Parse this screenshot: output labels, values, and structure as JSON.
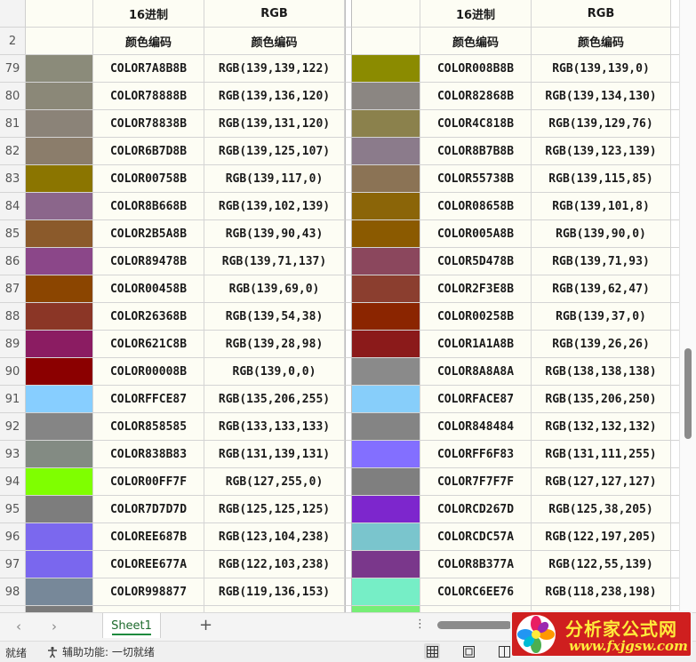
{
  "headers": {
    "row1": {
      "num": "",
      "hex": "16进制",
      "rgb": "RGB",
      "hex2": "16进制",
      "rgb2": "RGB"
    },
    "row2": {
      "num": "2",
      "hex": "颜色编码",
      "rgb": "颜色编码",
      "hex2": "颜色编码",
      "rgb2": "颜色编码"
    }
  },
  "rows": [
    {
      "num": "79",
      "c1": "#8b8b7a",
      "h1": "COLOR7A8B8B",
      "r1": "RGB(139,139,122)",
      "c2": "#8b8b00",
      "h2": "COLOR008B8B",
      "r2": "RGB(139,139,0)"
    },
    {
      "num": "80",
      "c1": "#8b8878",
      "h1": "COLOR78888B",
      "r1": "RGB(139,136,120)",
      "c2": "#8b8682",
      "h2": "COLOR82868B",
      "r2": "RGB(139,134,130)"
    },
    {
      "num": "81",
      "c1": "#8b8378",
      "h1": "COLOR78838B",
      "r1": "RGB(139,131,120)",
      "c2": "#8b814c",
      "h2": "COLOR4C818B",
      "r2": "RGB(139,129,76)"
    },
    {
      "num": "82",
      "c1": "#8b7d6b",
      "h1": "COLOR6B7D8B",
      "r1": "RGB(139,125,107)",
      "c2": "#8b7b8b",
      "h2": "COLOR8B7B8B",
      "r2": "RGB(139,123,139)"
    },
    {
      "num": "83",
      "c1": "#8b7500",
      "h1": "COLOR00758B",
      "r1": "RGB(139,117,0)",
      "c2": "#8b7355",
      "h2": "COLOR55738B",
      "r2": "RGB(139,115,85)"
    },
    {
      "num": "84",
      "c1": "#8b668b",
      "h1": "COLOR8B668B",
      "r1": "RGB(139,102,139)",
      "c2": "#8b6508",
      "h2": "COLOR08658B",
      "r2": "RGB(139,101,8)"
    },
    {
      "num": "85",
      "c1": "#8b5a2b",
      "h1": "COLOR2B5A8B",
      "r1": "RGB(139,90,43)",
      "c2": "#8b5a00",
      "h2": "COLOR005A8B",
      "r2": "RGB(139,90,0)"
    },
    {
      "num": "86",
      "c1": "#8b4789",
      "h1": "COLOR89478B",
      "r1": "RGB(139,71,137)",
      "c2": "#8b475d",
      "h2": "COLOR5D478B",
      "r2": "RGB(139,71,93)"
    },
    {
      "num": "87",
      "c1": "#8b4500",
      "h1": "COLOR00458B",
      "r1": "RGB(139,69,0)",
      "c2": "#8b3e2f",
      "h2": "COLOR2F3E8B",
      "r2": "RGB(139,62,47)"
    },
    {
      "num": "88",
      "c1": "#8b3626",
      "h1": "COLOR26368B",
      "r1": "RGB(139,54,38)",
      "c2": "#8b2500",
      "h2": "COLOR00258B",
      "r2": "RGB(139,37,0)"
    },
    {
      "num": "89",
      "c1": "#8b1c62",
      "h1": "COLOR621C8B",
      "r1": "RGB(139,28,98)",
      "c2": "#8b1a1a",
      "h2": "COLOR1A1A8B",
      "r2": "RGB(139,26,26)"
    },
    {
      "num": "90",
      "c1": "#8b0000",
      "h1": "COLOR00008B",
      "r1": "RGB(139,0,0)",
      "c2": "#8a8a8a",
      "h2": "COLOR8A8A8A",
      "r2": "RGB(138,138,138)"
    },
    {
      "num": "91",
      "c1": "#87ceff",
      "h1": "COLORFFCE87",
      "r1": "RGB(135,206,255)",
      "c2": "#87cefa",
      "h2": "COLORFACE87",
      "r2": "RGB(135,206,250)"
    },
    {
      "num": "92",
      "c1": "#858585",
      "h1": "COLOR858585",
      "r1": "RGB(133,133,133)",
      "c2": "#848484",
      "h2": "COLOR848484",
      "r2": "RGB(132,132,132)"
    },
    {
      "num": "93",
      "c1": "#838b83",
      "h1": "COLOR838B83",
      "r1": "RGB(131,139,131)",
      "c2": "#836fff",
      "h2": "COLORFF6F83",
      "r2": "RGB(131,111,255)"
    },
    {
      "num": "94",
      "c1": "#7fff00",
      "h1": "COLOR00FF7F",
      "r1": "RGB(127,255,0)",
      "c2": "#7f7f7f",
      "h2": "COLOR7F7F7F",
      "r2": "RGB(127,127,127)"
    },
    {
      "num": "95",
      "c1": "#7d7d7d",
      "h1": "COLOR7D7D7D",
      "r1": "RGB(125,125,125)",
      "c2": "#7d26cd",
      "h2": "COLORCD267D",
      "r2": "RGB(125,38,205)"
    },
    {
      "num": "96",
      "c1": "#7b68ee",
      "h1": "COLOREE687B",
      "r1": "RGB(123,104,238)",
      "c2": "#7ac5cd",
      "h2": "COLORCDC57A",
      "r2": "RGB(122,197,205)"
    },
    {
      "num": "97",
      "c1": "#7a67ee",
      "h1": "COLOREE677A",
      "r1": "RGB(122,103,238)",
      "c2": "#7a378b",
      "h2": "COLOR8B377A",
      "r2": "RGB(122,55,139)"
    },
    {
      "num": "98",
      "c1": "#778899",
      "h1": "COLOR998877",
      "r1": "RGB(119,136,153)",
      "c2": "#76eec6",
      "h2": "COLORC6EE76",
      "r2": "RGB(118,238,198)"
    }
  ],
  "partial_row": {
    "c1": "#7a7a7a",
    "c2": "#76ee76"
  },
  "tabs": {
    "prev_icon": "‹",
    "next_icon": "›",
    "sheet_name": "Sheet1",
    "add_icon": "+",
    "more_icon": "⋮"
  },
  "status": {
    "ready": "就绪",
    "accessibility": "辅助功能: 一切就绪"
  },
  "watermark": {
    "name": "分析家公式网",
    "url": "www.fxjgsw.com"
  }
}
